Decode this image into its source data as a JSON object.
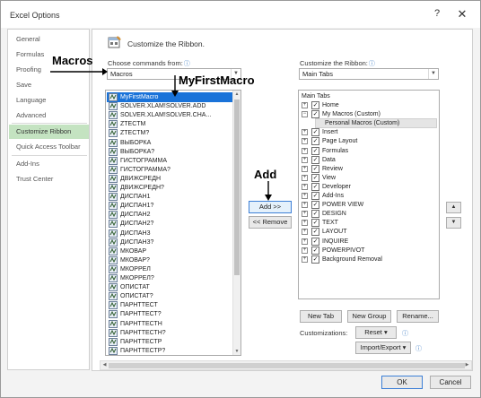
{
  "window": {
    "title": "Excel Options",
    "help": "?",
    "close": "✕"
  },
  "nav": {
    "items": [
      {
        "label": "General"
      },
      {
        "label": "Formulas"
      },
      {
        "label": "Proofing"
      },
      {
        "label": "Save"
      },
      {
        "label": "Language"
      },
      {
        "label": "Advanced"
      },
      {
        "label": "Customize Ribbon",
        "selected": true
      },
      {
        "label": "Quick Access Toolbar"
      },
      {
        "label": "Add-Ins"
      },
      {
        "label": "Trust Center"
      }
    ]
  },
  "heading": "Customize the Ribbon.",
  "left": {
    "label": "Choose commands from:",
    "combo_value": "Macros",
    "commands": [
      "MyFirstMacro",
      "SOLVER.XLAM!SOLVER.ADD",
      "SOLVER.XLAM!SOLVER.CHA...",
      "ZTECTM",
      "ZTECTM?",
      "ВЫБОРКА",
      "ВЫБОРКА?",
      "ГИСТОГРАММА",
      "ГИСТОГРАММА?",
      "ДВИЖСРЕДН",
      "ДВИЖСРЕДН?",
      "ДИСПАН1",
      "ДИСПАН1?",
      "ДИСПАН2",
      "ДИСПАН2?",
      "ДИСПАН3",
      "ДИСПАН3?",
      "МКОВАР",
      "МКОВАР?",
      "МКОРРЕЛ",
      "МКОРРЕЛ?",
      "ОПИСТАТ",
      "ОПИСТАТ?",
      "ПАРНТТЕСТ",
      "ПАРНТТЕСТ?",
      "ПАРНТТЕСТН",
      "ПАРНТТЕСТН?",
      "ПАРНТТЕСТР",
      "ПАРНТТЕСТР?"
    ]
  },
  "right": {
    "label": "Customize the Ribbon:",
    "combo_value": "Main Tabs",
    "tree_header": "Main Tabs",
    "tabs": [
      {
        "label": "Home",
        "expander": "+",
        "checked": true
      },
      {
        "label": "My Macros (Custom)",
        "expander": "−",
        "checked": true
      },
      {
        "label": "Personal Macros (Custom)",
        "group": true
      },
      {
        "label": "Insert",
        "expander": "+",
        "checked": true
      },
      {
        "label": "Page Layout",
        "expander": "+",
        "checked": true
      },
      {
        "label": "Formulas",
        "expander": "+",
        "checked": true
      },
      {
        "label": "Data",
        "expander": "+",
        "checked": true
      },
      {
        "label": "Review",
        "expander": "+",
        "checked": true
      },
      {
        "label": "View",
        "expander": "+",
        "checked": true
      },
      {
        "label": "Developer",
        "expander": "+",
        "checked": true
      },
      {
        "label": "Add-Ins",
        "expander": "+",
        "checked": true
      },
      {
        "label": "POWER VIEW",
        "expander": "+",
        "checked": true
      },
      {
        "label": "DESIGN",
        "expander": "+",
        "checked": true
      },
      {
        "label": "TEXT",
        "expander": "+",
        "checked": true
      },
      {
        "label": "LAYOUT",
        "expander": "+",
        "checked": true
      },
      {
        "label": "INQUIRE",
        "expander": "+",
        "checked": true
      },
      {
        "label": "POWERPIVOT",
        "expander": "+",
        "checked": true
      },
      {
        "label": "Background Removal",
        "expander": "+",
        "checked": true
      }
    ]
  },
  "buttons": {
    "add": "Add >>",
    "remove": "<< Remove",
    "new_tab": "New Tab",
    "new_group": "New Group",
    "rename": "Rename...",
    "reset": "Reset ▾",
    "import_export": "Import/Export ▾",
    "ok": "OK",
    "cancel": "Cancel",
    "move_up": "▲",
    "move_down": "▼"
  },
  "customizations_label": "Customizations:",
  "annotations": {
    "macros": "Macros",
    "myfirstmacro": "MyFirstMacro",
    "add": "Add"
  },
  "colors": {
    "selected_nav": "#c4e3c1",
    "selected_row": "#1a73d9",
    "info": "#3a7bc4"
  }
}
